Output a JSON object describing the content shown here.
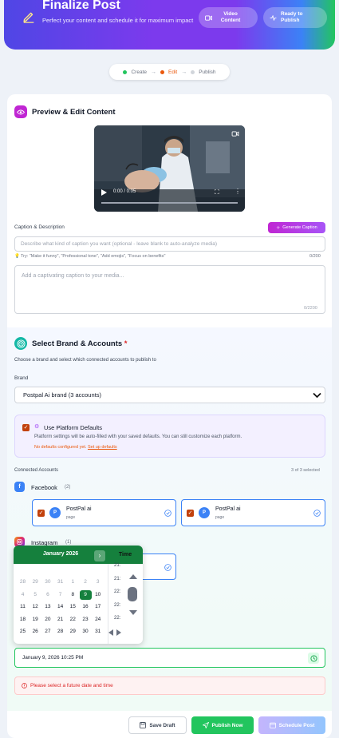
{
  "header": {
    "title": "Finalize Post",
    "subtitle": "Perfect your content and schedule it for maximum impact",
    "pill_video": "Video Content",
    "pill_ready": "Ready to Publish",
    "pencil_icon": "pencil-icon",
    "video_icon": "video-camera-icon",
    "ready_icon": "activity-icon"
  },
  "stepper": {
    "steps": [
      {
        "label": "Create",
        "color": "#22c55e"
      },
      {
        "label": "Edit",
        "color": "#ea580c"
      },
      {
        "label": "Publish",
        "color": "#d1d5db"
      }
    ]
  },
  "preview": {
    "title": "Preview & Edit Content",
    "video_time": "0:00 / 0:05",
    "caption_label": "Caption & Description",
    "generate_label": "Generate Caption",
    "prompt_placeholder": "Describe what kind of caption you want (optional - leave blank to auto-analyze media)",
    "tip": "Try: \"Make it funny\", \"Professional tone\", \"Add emojis\", \"Focus on benefits\"",
    "prompt_count": "0/200",
    "caption_placeholder": "Add a captivating caption to your media...",
    "caption_count": "0/2200"
  },
  "brand": {
    "title": "Select Brand & Accounts",
    "required": "*",
    "description": "Choose a brand and select which connected accounts to publish to",
    "brand_label": "Brand",
    "selected_brand": "Postpal Ai brand (3 accounts)",
    "defaults_title": "Use Platform Defaults",
    "defaults_desc": "Platform settings will be auto-filled with your saved defaults. You can still customize each platform.",
    "defaults_warning": "No defaults configured yet.",
    "setup_link": "Set up defaults",
    "connected_label": "Connected Accounts",
    "selected_count": "3 of 3 selected"
  },
  "platforms": {
    "facebook": {
      "name": "Facebook",
      "count": "(2)",
      "accounts": [
        {
          "name": "PostPal ai",
          "type": "page",
          "avatar": "P"
        },
        {
          "name": "PostPal ai",
          "type": "page",
          "avatar": "P"
        }
      ]
    },
    "instagram": {
      "name": "Instagram",
      "count": "(1)"
    }
  },
  "datepicker": {
    "month": "January 2026",
    "time_header": "Time",
    "next_label": "›",
    "weeks": [
      [
        "28",
        "29",
        "30",
        "31",
        "1",
        "2",
        "3"
      ],
      [
        "4",
        "5",
        "6",
        "7",
        "8",
        "9",
        "10"
      ],
      [
        "11",
        "12",
        "13",
        "14",
        "15",
        "16",
        "17"
      ],
      [
        "18",
        "19",
        "20",
        "21",
        "22",
        "23",
        "24"
      ],
      [
        "25",
        "26",
        "27",
        "28",
        "29",
        "30",
        "31"
      ]
    ],
    "selected_day": "9",
    "times": [
      "21:",
      "21:",
      "22:",
      "22:",
      "22:"
    ]
  },
  "schedule": {
    "datetime_value": "January 9, 2026 10:25 PM",
    "error": "Please select a future date and time"
  },
  "actions": {
    "save_draft": "Save Draft",
    "publish_now": "Publish Now",
    "schedule_post": "Schedule Post"
  }
}
